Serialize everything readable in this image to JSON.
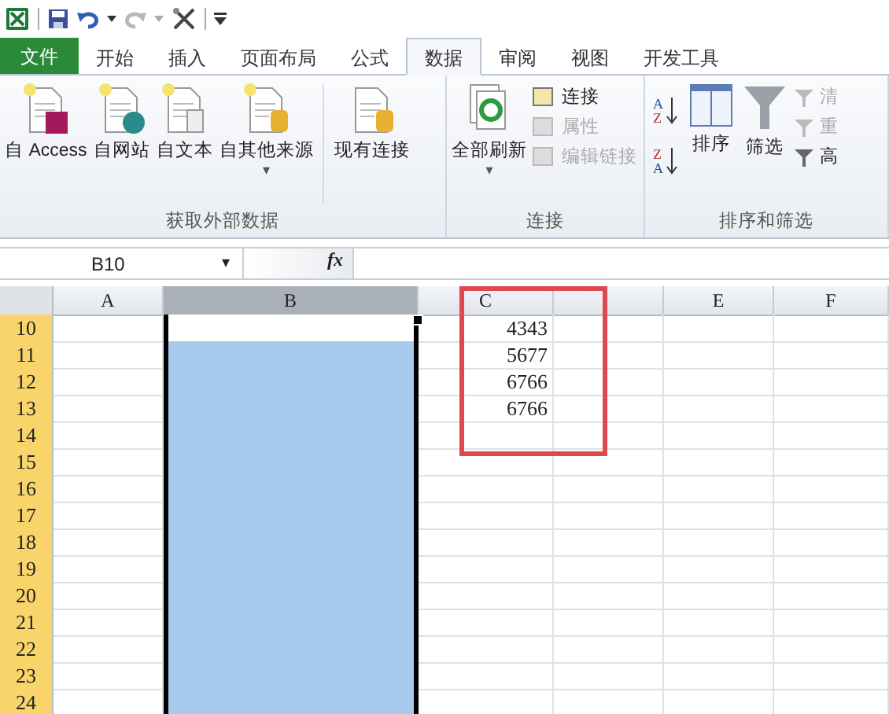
{
  "file_tab": "文件",
  "tabs": [
    {
      "label": "开始",
      "selected": false
    },
    {
      "label": "插入",
      "selected": false
    },
    {
      "label": "页面布局",
      "selected": false
    },
    {
      "label": "公式",
      "selected": false
    },
    {
      "label": "数据",
      "selected": true
    },
    {
      "label": "审阅",
      "selected": false
    },
    {
      "label": "视图",
      "selected": false
    },
    {
      "label": "开发工具",
      "selected": false
    }
  ],
  "ribbon": {
    "external_data": {
      "buttons": [
        {
          "label": "自 Access"
        },
        {
          "label": "自网站"
        },
        {
          "label": "自文本"
        },
        {
          "label": "自其他来源",
          "dropdown": "▾"
        }
      ],
      "existing": "现有连接",
      "label": "获取外部数据"
    },
    "connections": {
      "refresh": {
        "label": "全部刷新",
        "dropdown": "▾"
      },
      "items": [
        {
          "label": "连接",
          "disabled": false
        },
        {
          "label": "属性",
          "disabled": true
        },
        {
          "label": "编辑链接",
          "disabled": true
        }
      ],
      "label": "连接"
    },
    "sort_filter": {
      "ascending": [
        "A",
        "Z"
      ],
      "descending": [
        "Z",
        "A"
      ],
      "sort": "排序",
      "filter": "筛选",
      "items": [
        {
          "label": "清",
          "disabled": true
        },
        {
          "label": "重",
          "disabled": true
        },
        {
          "label": "高",
          "disabled": false
        }
      ],
      "label": "排序和筛选"
    }
  },
  "formula_bar": {
    "name_box": "B10",
    "dropdown": "▾",
    "fx": "fx"
  },
  "sheet": {
    "columns": [
      {
        "label": "A",
        "selected": false
      },
      {
        "label": "B",
        "selected": true
      },
      {
        "label": "C",
        "selected": false
      },
      {
        "selected": false
      },
      {
        "label": "E",
        "selected": false
      },
      {
        "label": "F",
        "selected": false
      }
    ],
    "rows": [
      {
        "label": "10",
        "selected": true,
        "active": true,
        "c": "4343"
      },
      {
        "label": "11",
        "selected": true,
        "active": false,
        "c": "5677"
      },
      {
        "label": "12",
        "selected": true,
        "active": false,
        "c": "6766"
      },
      {
        "label": "13",
        "selected": true,
        "active": false,
        "c": "6766"
      },
      {
        "label": "14",
        "selected": true,
        "active": false
      },
      {
        "label": "15",
        "selected": true,
        "active": false
      },
      {
        "label": "16",
        "selected": true,
        "active": false
      },
      {
        "label": "17",
        "selected": true,
        "active": false
      },
      {
        "label": "18",
        "selected": true,
        "active": false
      },
      {
        "label": "19",
        "selected": true,
        "active": false
      },
      {
        "label": "20",
        "selected": true,
        "active": false
      },
      {
        "label": "21",
        "selected": true,
        "active": false
      },
      {
        "label": "22",
        "selected": true,
        "active": false
      },
      {
        "label": "23",
        "selected": true,
        "active": false
      },
      {
        "label": "24",
        "selected": true,
        "active": false
      }
    ]
  }
}
